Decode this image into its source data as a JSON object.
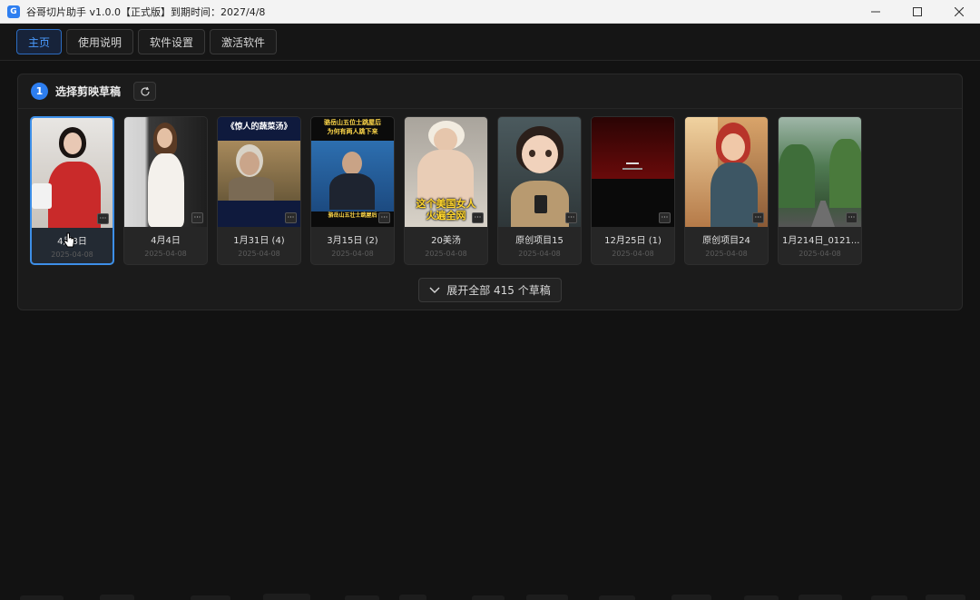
{
  "window": {
    "title": "谷哥切片助手 v1.0.0【正式版】到期时间：2027/4/8",
    "icon": "app-logo-icon",
    "controls": [
      "minimize-icon",
      "maximize-icon",
      "close-icon"
    ]
  },
  "nav": {
    "tabs": [
      {
        "label": "主页",
        "active": true
      },
      {
        "label": "使用说明",
        "active": false
      },
      {
        "label": "软件设置",
        "active": false
      },
      {
        "label": "激活软件",
        "active": false
      }
    ]
  },
  "panel": {
    "step": "1",
    "title": "选择剪映草稿",
    "refresh_icon": "refresh-icon",
    "expand_label": "展开全部 415 个草稿",
    "expand_icon": "chevron-down-icon"
  },
  "drafts": [
    {
      "name": "4月8日",
      "date": "2025-04-08",
      "selected": true,
      "badge": "···"
    },
    {
      "name": "4月4日",
      "date": "2025-04-08",
      "selected": false,
      "badge": "···"
    },
    {
      "name": "1月31日 (4)",
      "date": "2025-04-08",
      "selected": false,
      "badge": "···",
      "thumb_text": "《惊人的蔬菜汤》"
    },
    {
      "name": "3月15日 (2)",
      "date": "2025-04-08",
      "selected": false,
      "badge": "···",
      "thumb_text_top": "骆岳山五位士跳屋后",
      "thumb_text_top2": "为何有两人跳下来",
      "thumb_text_bottom": "骆岳山五壮士跳屋后"
    },
    {
      "name": "20美汤",
      "date": "2025-04-08",
      "selected": false,
      "badge": "···",
      "thumb_text": "这个美国女人\n火遍全网"
    },
    {
      "name": "原创项目15",
      "date": "2025-04-08",
      "selected": false,
      "badge": "···"
    },
    {
      "name": "12月25日 (1)",
      "date": "2025-04-08",
      "selected": false,
      "badge": "···"
    },
    {
      "name": "原创项目24",
      "date": "2025-04-08",
      "selected": false,
      "badge": "···"
    },
    {
      "name": "1月214日_0121...",
      "date": "2025-04-08",
      "selected": false,
      "badge": "···"
    }
  ],
  "colors": {
    "accent": "#2d7ef0",
    "background": "#121212",
    "panel": "#1b1b1b"
  }
}
